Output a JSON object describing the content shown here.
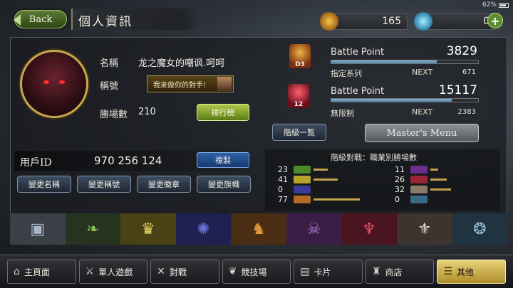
{
  "status": {
    "battery": "62%"
  },
  "header": {
    "back_label": "Back",
    "title": "個人資訊"
  },
  "currency": {
    "gold": "165",
    "crystal": "0",
    "plus": "+"
  },
  "profile": {
    "name_label": "名稱",
    "name_value": "龙之魔女的嘲讽.呵呵",
    "title_label": "稱號",
    "title_value": "我來做你的對手!",
    "wins_label": "勝場數",
    "wins_value": "210",
    "ranking_button": "排行榜",
    "userid_label": "用戶ID",
    "userid_value": "970 256 124",
    "copy_button": "複製"
  },
  "battle": {
    "rows": [
      {
        "rank": "D3",
        "label": "Battle Point",
        "value": "3829",
        "sub": "指定系列",
        "next_label": "NEXT",
        "next_value": "671",
        "progress": 0.72
      },
      {
        "rank": "12",
        "label": "Battle Point",
        "value": "15117",
        "sub": "無限制",
        "next_label": "NEXT",
        "next_value": "2383",
        "progress": 0.82
      }
    ],
    "grade_button": "階級一覧",
    "master_button": "Master's Menu"
  },
  "change_buttons": [
    "變更名稱",
    "變更稱號",
    "變更徽章",
    "變更旗幟"
  ],
  "stats": {
    "title": "階級對戰：職業別勝場數",
    "left": [
      {
        "value": "23",
        "color": "#4f8a2a",
        "bar": 0.22
      },
      {
        "value": "41",
        "color": "#b8a128",
        "bar": 0.38
      },
      {
        "value": "0",
        "color": "#3a3a9a",
        "bar": 0.0
      },
      {
        "value": "77",
        "color": "#b46a26",
        "bar": 0.72
      }
    ],
    "right": [
      {
        "value": "11",
        "color": "#6a2f8a",
        "bar": 0.12
      },
      {
        "value": "26",
        "color": "#9a2438",
        "bar": 0.26
      },
      {
        "value": "32",
        "color": "#8a7a6a",
        "bar": 0.32
      },
      {
        "value": "0",
        "color": "#3a6a8a",
        "bar": 0.0
      }
    ]
  },
  "classes": [
    {
      "icon": "card-back-icon",
      "glyph": "▣",
      "bg": "#3b3f46",
      "fg": "#a9b7c9"
    },
    {
      "icon": "leaf-icon",
      "glyph": "❧",
      "bg": "#26331f",
      "fg": "#7fc04a"
    },
    {
      "icon": "crown-icon",
      "glyph": "♛",
      "bg": "#4a4214",
      "fg": "#e9d36a"
    },
    {
      "icon": "rune-star-icon",
      "glyph": "✺",
      "bg": "#1e2050",
      "fg": "#6d6fd8"
    },
    {
      "icon": "dragon-icon",
      "glyph": "♞",
      "bg": "#4a2d12",
      "fg": "#e09a3c"
    },
    {
      "icon": "skull-icon",
      "glyph": "☠",
      "bg": "#3a1e45",
      "fg": "#b978d8"
    },
    {
      "icon": "bat-icon",
      "glyph": "♆",
      "bg": "#4a1420",
      "fg": "#e04a62"
    },
    {
      "icon": "angel-wings-icon",
      "glyph": "⚜",
      "bg": "#3c342e",
      "fg": "#e6dccd"
    },
    {
      "icon": "sigil-icon",
      "glyph": "❂",
      "bg": "#1f3340",
      "fg": "#8dc4d8"
    }
  ],
  "nav": [
    {
      "icon": "home-icon",
      "glyph": "⌂",
      "label": "主頁面"
    },
    {
      "icon": "sword-person-icon",
      "glyph": "⚔",
      "label": "單人遊戲"
    },
    {
      "icon": "crossed-swords-icon",
      "glyph": "✕",
      "label": "對戰"
    },
    {
      "icon": "laurel-icon",
      "glyph": "❦",
      "label": "競技場"
    },
    {
      "icon": "cards-icon",
      "glyph": "▤",
      "label": "卡片"
    },
    {
      "icon": "shop-icon",
      "glyph": "♜",
      "label": "商店"
    },
    {
      "icon": "other-icon",
      "glyph": "☰",
      "label": "其他"
    }
  ]
}
